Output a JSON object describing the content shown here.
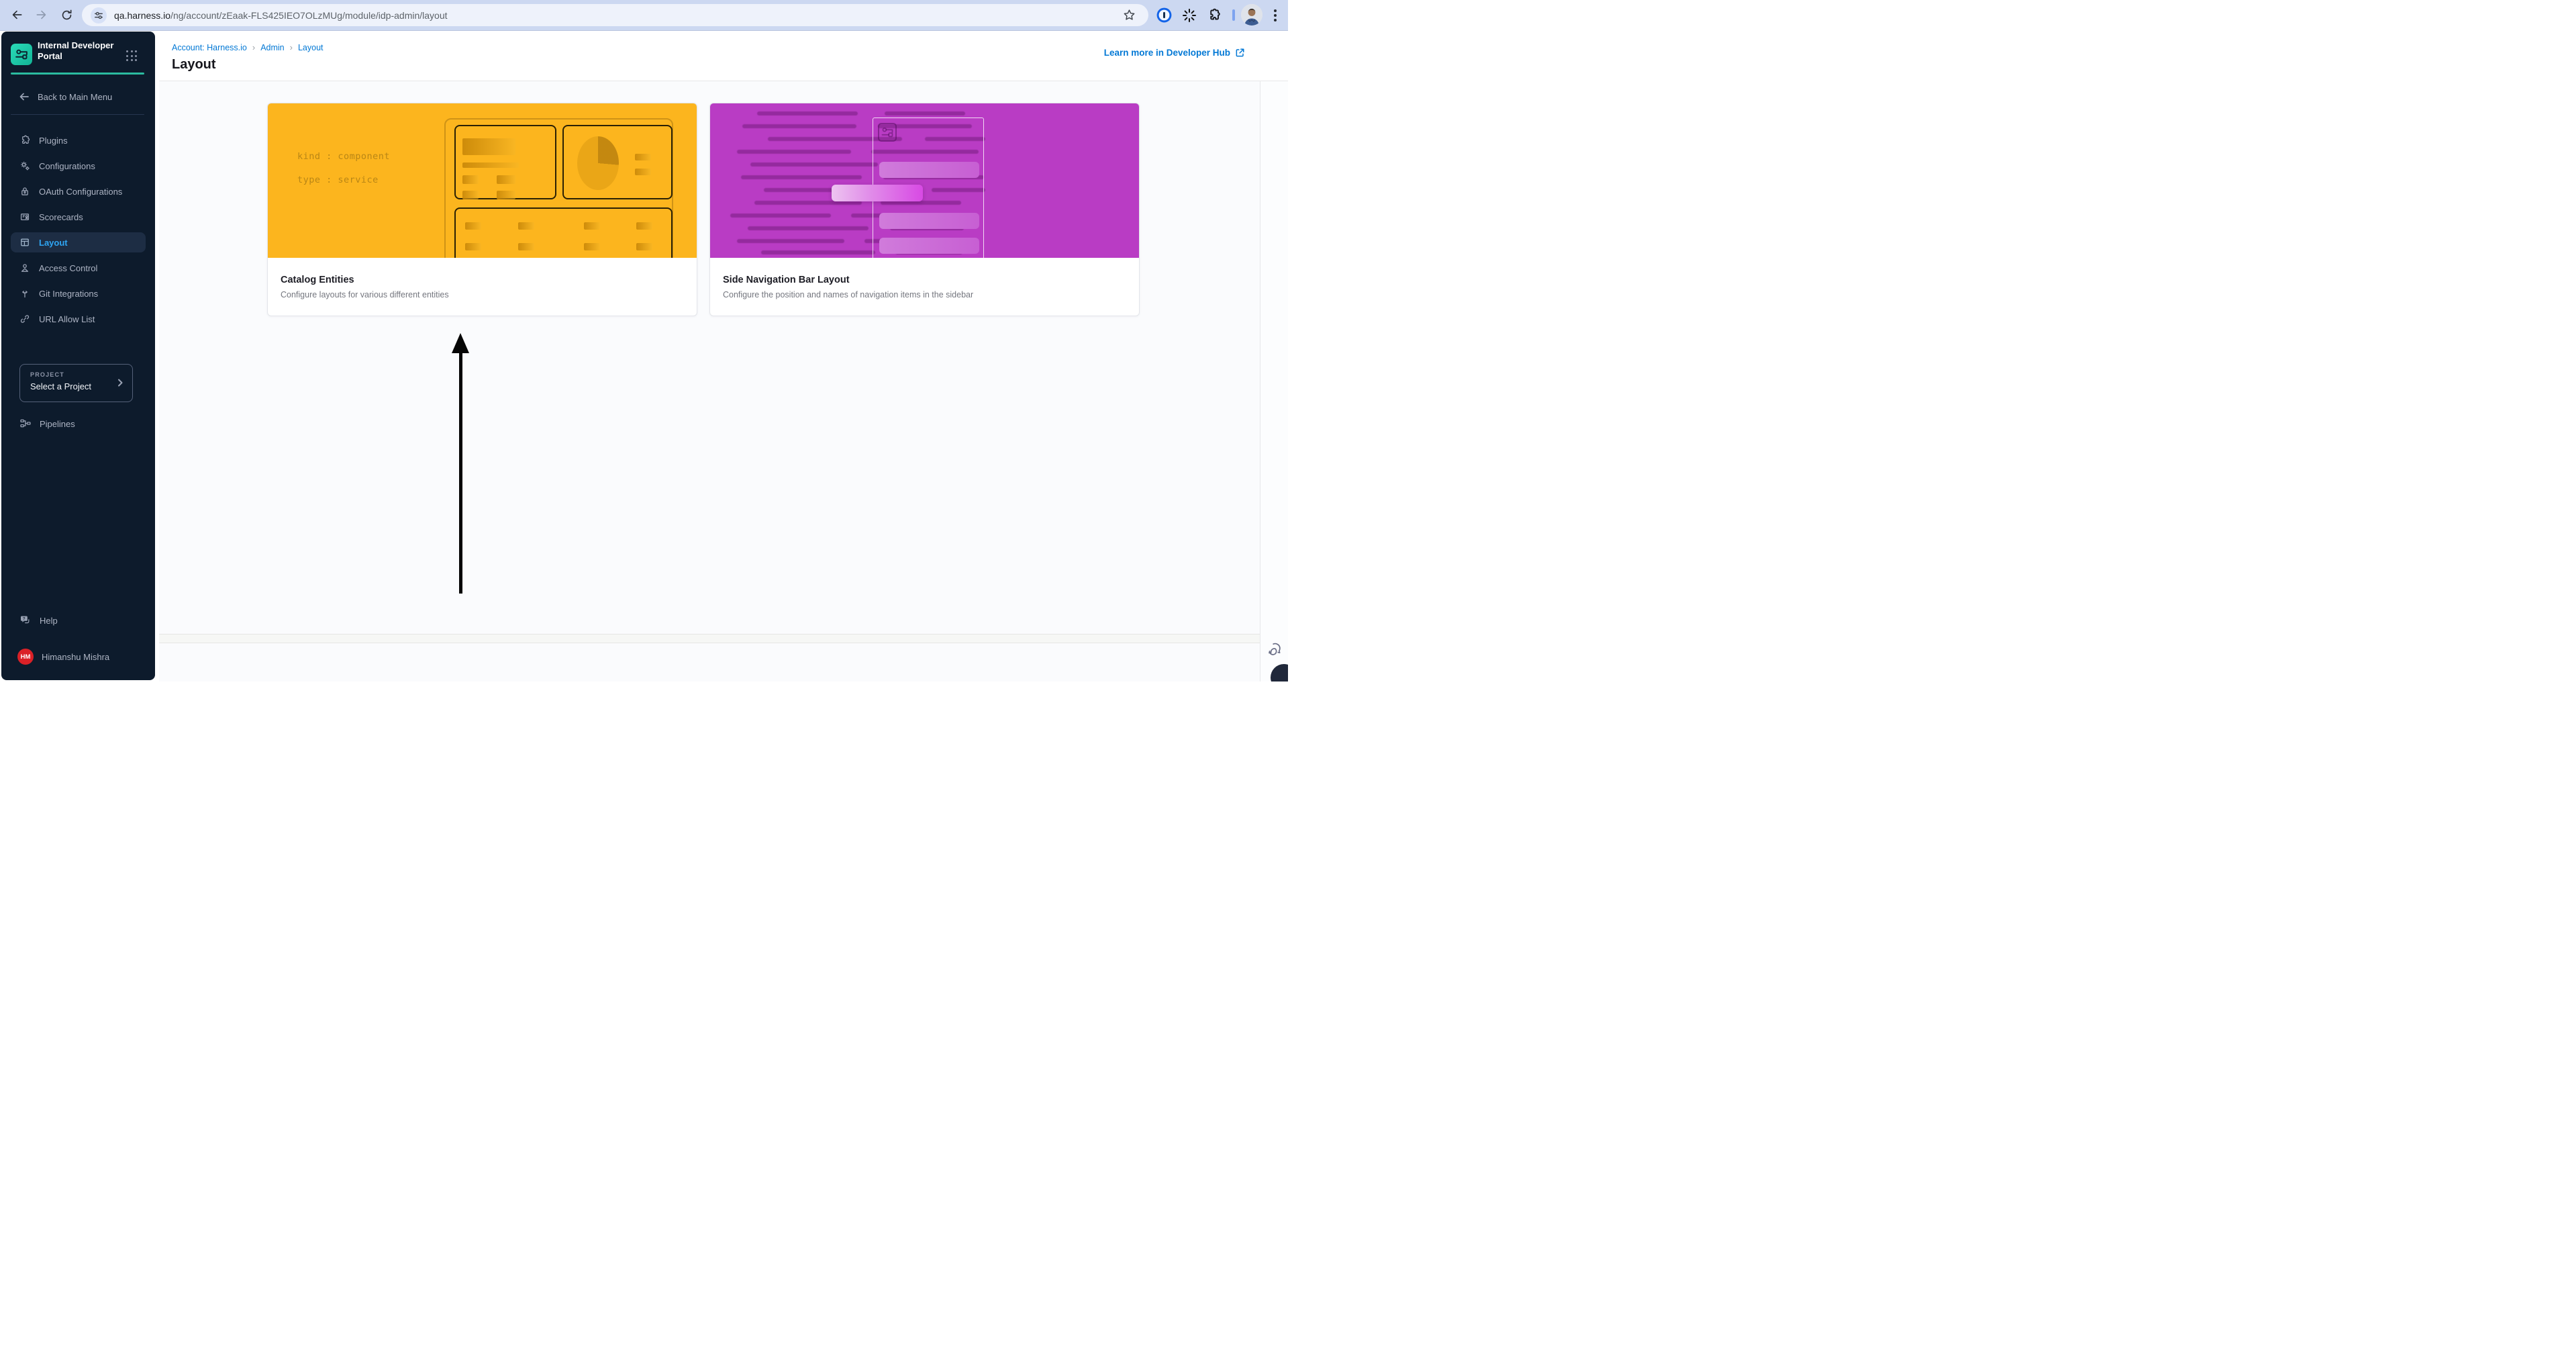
{
  "browser": {
    "url": {
      "domain": "qa.harness.io",
      "path": "/ng/account/zEaak-FLS425IEO7OLzMUg/module/idp-admin/layout"
    }
  },
  "sidebar": {
    "product_title": "Internal Developer Portal",
    "back_label": "Back to Main Menu",
    "items": [
      {
        "label": "Plugins"
      },
      {
        "label": "Configurations"
      },
      {
        "label": "OAuth Configurations"
      },
      {
        "label": "Scorecards"
      },
      {
        "label": "Layout"
      },
      {
        "label": "Access Control"
      },
      {
        "label": "Git Integrations"
      },
      {
        "label": "URL Allow List"
      }
    ],
    "project": {
      "label": "PROJECT",
      "value": "Select a Project"
    },
    "pipelines_label": "Pipelines",
    "help_label": "Help",
    "user": {
      "name": "Himanshu Mishra",
      "initials": "HM"
    }
  },
  "header": {
    "breadcrumb": {
      "account": "Account: Harness.io",
      "admin": "Admin",
      "current": "Layout"
    },
    "title": "Layout",
    "learn_more_label": "Learn more in Developer Hub"
  },
  "cards": {
    "catalog": {
      "title": "Catalog Entities",
      "description": "Configure layouts for various different entities",
      "code_line_1": "kind : component",
      "code_line_2": "type : service",
      "accent_color": "#FCB51E"
    },
    "sidenav": {
      "title": "Side Navigation Bar Layout",
      "description": "Configure the position and names of navigation items in the sidebar",
      "accent_color": "#B93CC4"
    }
  },
  "colors": {
    "sidebar_bg": "#0D1B2C",
    "active_item_text": "#2EA5F3",
    "teal_divider": "#2BBBA0",
    "link_blue": "#0278D5",
    "avatar_red": "#DA2127"
  }
}
